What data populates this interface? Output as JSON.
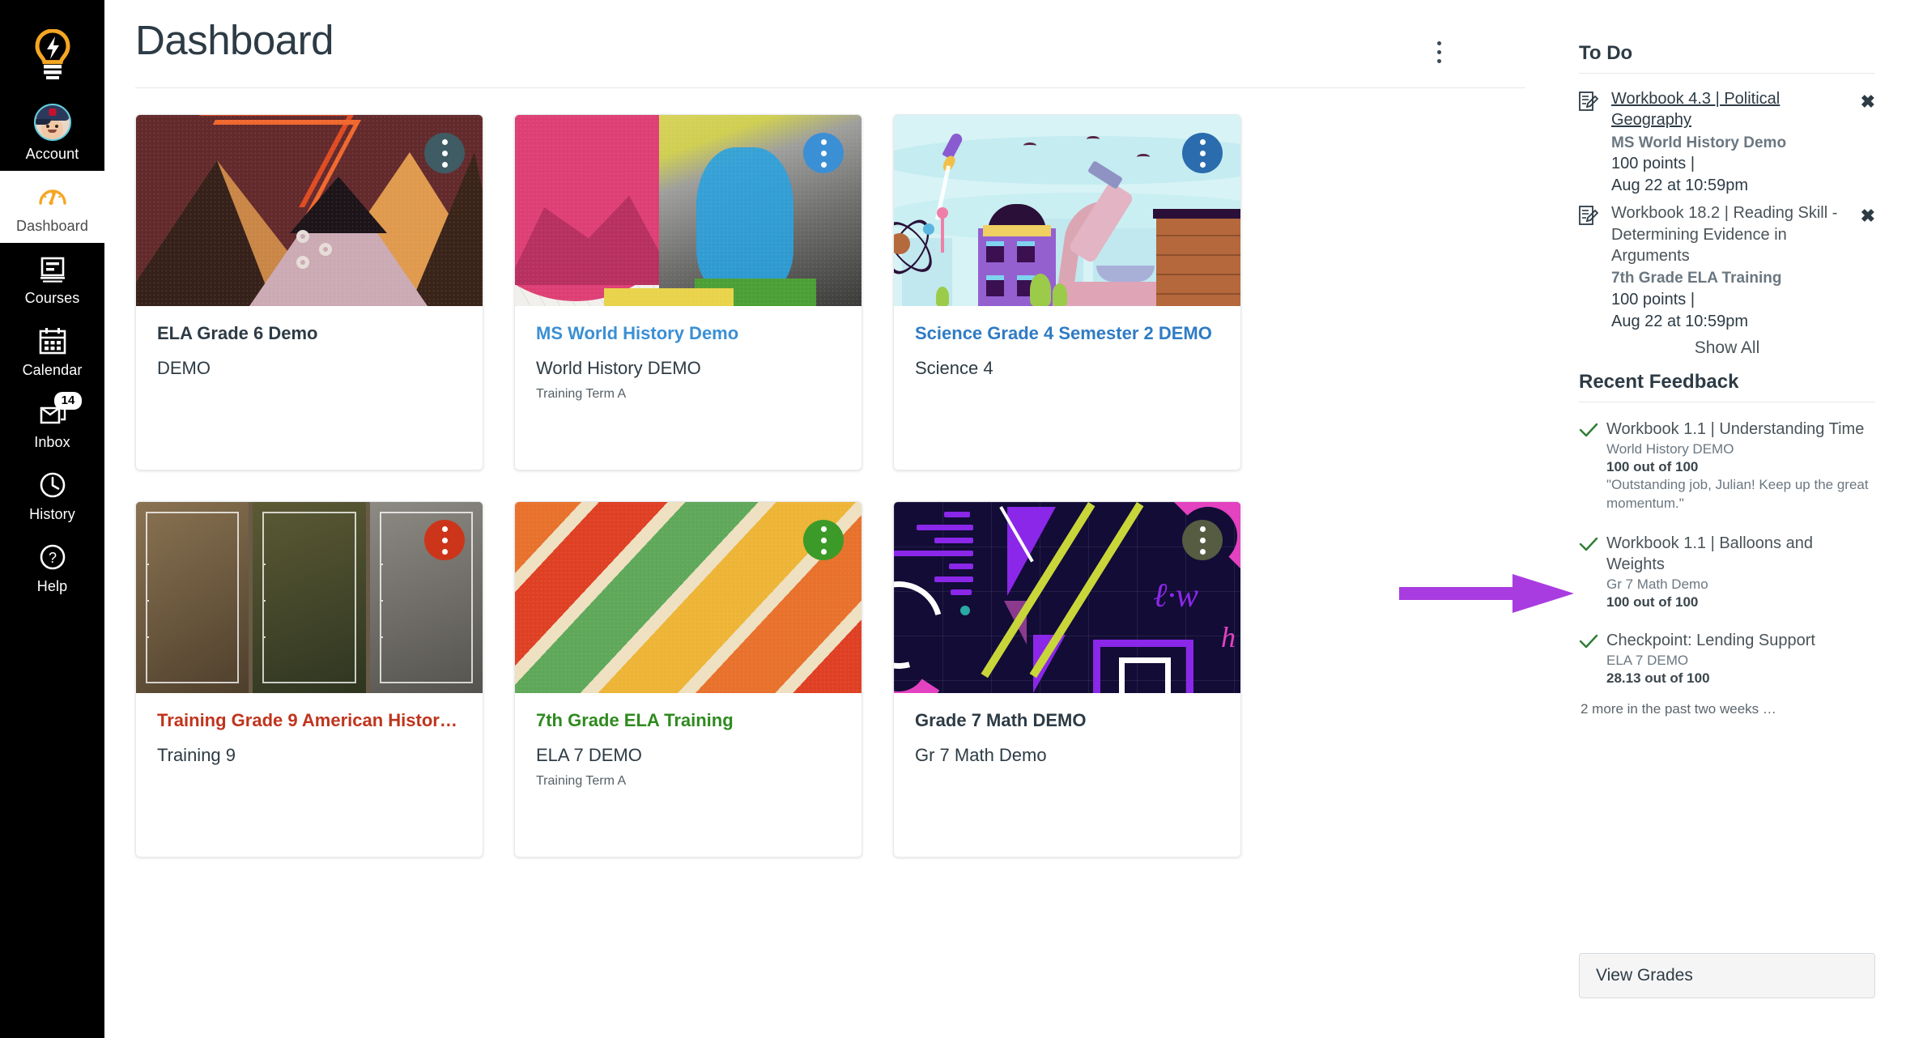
{
  "colors": {
    "nav_bg": "#000000",
    "accent_yellow": "#f5a623",
    "arrow_purple": "#a93ce0",
    "link_blue": "#2f7bc4",
    "link_red": "#c0341d",
    "link_green": "#2f8a1f"
  },
  "globalnav": {
    "logo_icon": "lightbulb-icon",
    "items": [
      {
        "label": "Account",
        "icon": "avatar-icon",
        "active": false,
        "badge": null
      },
      {
        "label": "Dashboard",
        "icon": "dashboard-gauge-icon",
        "active": true,
        "badge": null
      },
      {
        "label": "Courses",
        "icon": "courses-book-icon",
        "active": false,
        "badge": null
      },
      {
        "label": "Calendar",
        "icon": "calendar-icon",
        "active": false,
        "badge": null
      },
      {
        "label": "Inbox",
        "icon": "inbox-icon",
        "active": false,
        "badge": "14"
      },
      {
        "label": "History",
        "icon": "clock-icon",
        "active": false,
        "badge": null
      },
      {
        "label": "Help",
        "icon": "question-circle-icon",
        "active": false,
        "badge": null
      }
    ]
  },
  "header": {
    "title": "Dashboard",
    "options_icon": "kebab-menu-icon"
  },
  "cards": [
    {
      "title": "ELA Grade 6 Demo",
      "title_color": "#2d3b45",
      "subtitle": "DEMO",
      "term": "",
      "kebab_color": "#3f5b63",
      "hero": "maroon-mountains",
      "kebab_icon": "kebab-menu-icon"
    },
    {
      "title": "MS World History Demo",
      "title_color": "#3b8fd4",
      "subtitle": "World History DEMO",
      "term": "Training Term A",
      "kebab_color": "#3b8fd4",
      "hero": "pink-statue-collage",
      "kebab_icon": "kebab-menu-icon"
    },
    {
      "title": "Science Grade 4 Semester 2 DEMO",
      "title_color": "#2f7bc4",
      "subtitle": "Science 4",
      "term": "",
      "kebab_color": "#2a6cad",
      "hero": "science-cityscape",
      "kebab_icon": "kebab-menu-icon"
    },
    {
      "title": "Training Grade 9 American History…",
      "title_color": "#c0341d",
      "subtitle": "Training 9",
      "term": "",
      "kebab_color": "#cc3519",
      "hero": "sepia-paintings",
      "kebab_icon": "kebab-menu-icon"
    },
    {
      "title": "7th Grade ELA Training",
      "title_color": "#2f8a1f",
      "subtitle": "ELA 7 DEMO",
      "term": "Training Term A",
      "kebab_color": "#3c9a29",
      "hero": "warm-diagonal-stripes",
      "kebab_icon": "kebab-menu-icon"
    },
    {
      "title": "Grade 7 Math DEMO",
      "title_color": "#2d3b45",
      "subtitle": "Gr 7 Math Demo",
      "term": "",
      "kebab_color": "#555c42",
      "hero": "math-geometry-dark",
      "kebab_icon": "kebab-menu-icon"
    }
  ],
  "todo": {
    "heading": "To Do",
    "show_all": "Show All",
    "items": [
      {
        "icon": "assignment-edit-icon",
        "title": "Workbook 4.3 | Political Geography",
        "underlined": true,
        "course": "MS World History Demo",
        "points": "100 points  |",
        "due": "Aug 22 at 10:59pm",
        "dismiss_icon": "close-x-icon"
      },
      {
        "icon": "assignment-edit-icon",
        "title": "Workbook 18.2 | Reading Skill - Determining Evidence in Arguments",
        "underlined": false,
        "course": "7th Grade ELA Training",
        "points": "100 points  |",
        "due": "Aug 22 at 10:59pm",
        "dismiss_icon": "close-x-icon"
      }
    ]
  },
  "recent_feedback": {
    "heading": "Recent Feedback",
    "more_text": "2 more in the past two weeks …",
    "items": [
      {
        "icon": "check-icon",
        "title": "Workbook 1.1 | Understanding Time",
        "course": "World History DEMO",
        "score": "100 out of 100",
        "comment": "\"Outstanding job, Julian! Keep up the great momentum.\""
      },
      {
        "icon": "check-icon",
        "title": "Workbook 1.1 | Balloons and Weights",
        "course": "Gr 7 Math Demo",
        "score": "100 out of 100",
        "comment": ""
      },
      {
        "icon": "check-icon",
        "title": "Checkpoint: Lending Support",
        "course": "ELA 7 DEMO",
        "score": "28.13 out of 100",
        "comment": ""
      }
    ]
  },
  "view_grades": {
    "label": "View Grades"
  },
  "annotation": {
    "type": "arrow",
    "color": "#a93ce0",
    "points_at": "100 out of 100"
  }
}
